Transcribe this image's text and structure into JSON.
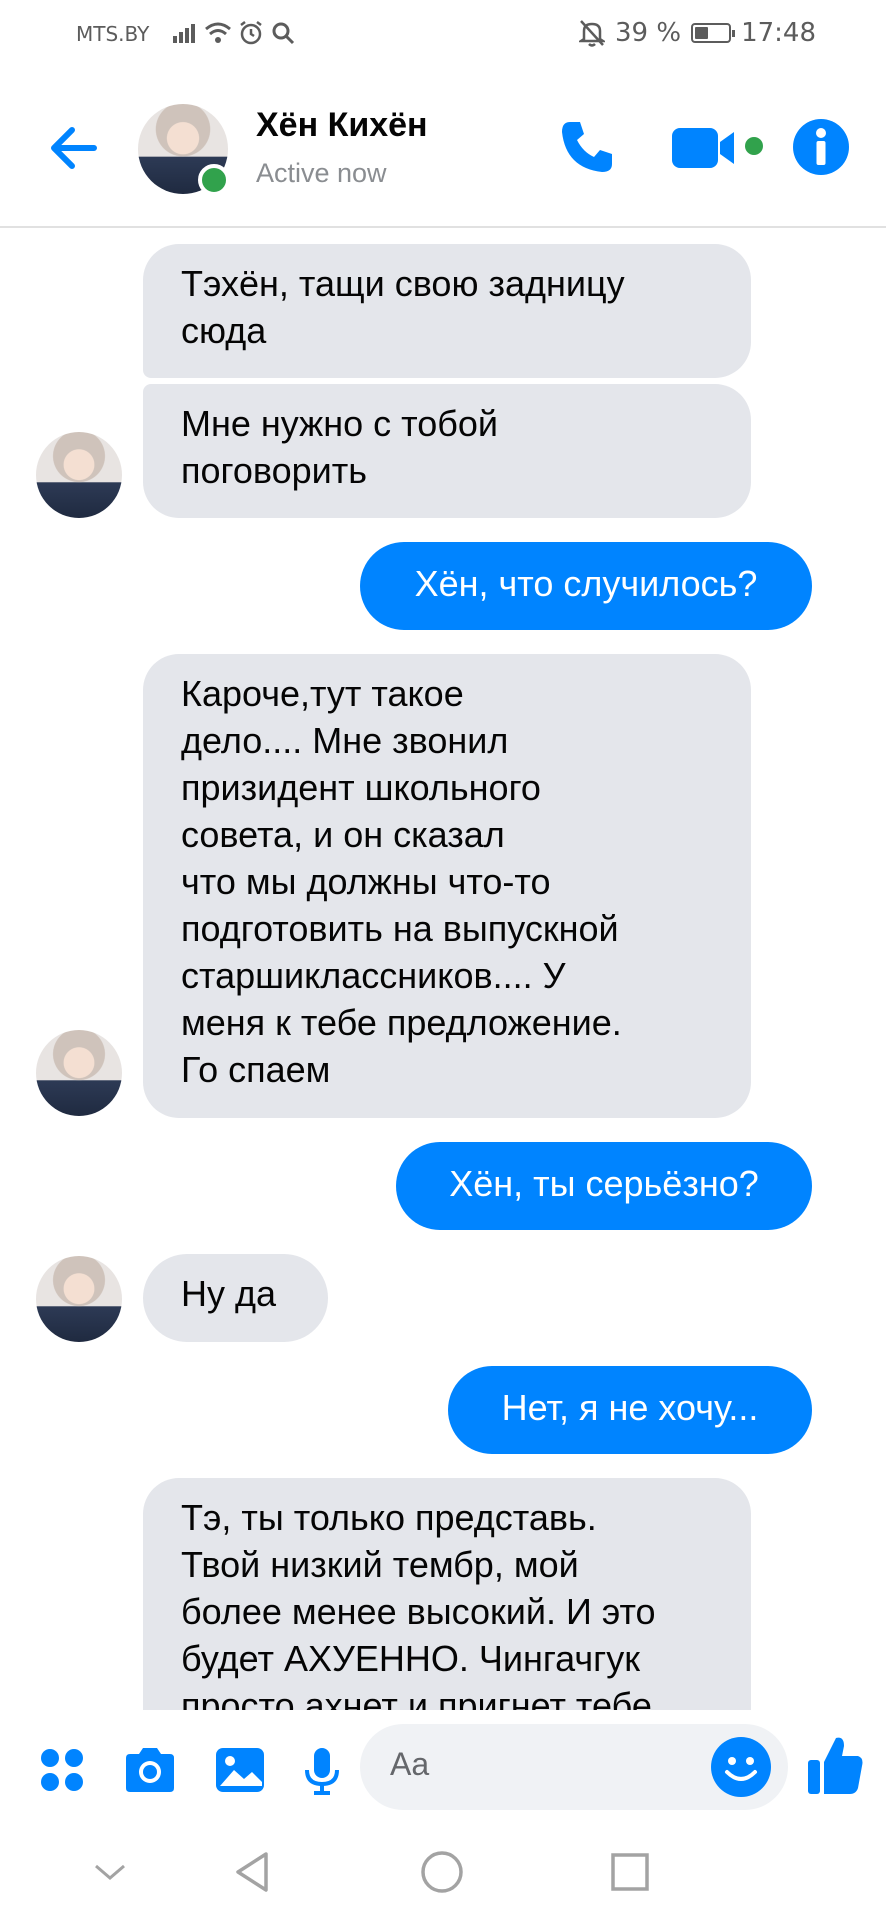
{
  "status_bar": {
    "carrier": "MTS.BY",
    "battery_percent": "39 %",
    "battery_level": 0.39,
    "time": "17:48",
    "icons": [
      "signal-icon",
      "wifi-icon",
      "alarm-icon",
      "search-icon",
      "bell-off-icon",
      "battery-icon"
    ]
  },
  "header": {
    "contact_name": "Хён Кихён",
    "contact_status": "Active now",
    "icons": [
      "back-arrow-icon",
      "phone-icon",
      "video-camera-icon",
      "info-icon"
    ],
    "accent_color": "#0084ff",
    "online_color": "#31a24c"
  },
  "messages": [
    {
      "side": "in",
      "text": "Тэхён, тащи свою задницу\nсюда"
    },
    {
      "side": "in",
      "text": "Мне нужно с тобой\nпоговорить"
    },
    {
      "side": "out",
      "text": "Хён, что случилось?"
    },
    {
      "side": "in",
      "text": "Кароче,тут  такое\nдело.... Мне звонил\nпризидент школьного\nсовета, и он сказал\nчто мы должны что-то\nподготовить на выпускной\nстаршиклассников.... У\nменя к тебе предложение.\nГо спаем"
    },
    {
      "side": "out",
      "text": "Хён, ты серьёзно?"
    },
    {
      "side": "in",
      "text": "Ну да"
    },
    {
      "side": "out",
      "text": "Нет, я не хочу..."
    },
    {
      "side": "in",
      "text": "Тэ, ты только представь.\nТвой низкий тембр, мой\nболее менее высокий. И это\nбудет АХУЕННО. Чингачгук\nпросто ахнет и пригнет тебе"
    }
  ],
  "composer": {
    "placeholder": "Aa",
    "icons": [
      "apps-grid-icon",
      "camera-icon",
      "gallery-icon",
      "microphone-icon",
      "emoji-icon",
      "thumbs-up-icon"
    ]
  },
  "nav_bar": {
    "icons": [
      "chevron-down-icon",
      "back-triangle-icon",
      "home-circle-icon",
      "recents-square-icon"
    ]
  }
}
